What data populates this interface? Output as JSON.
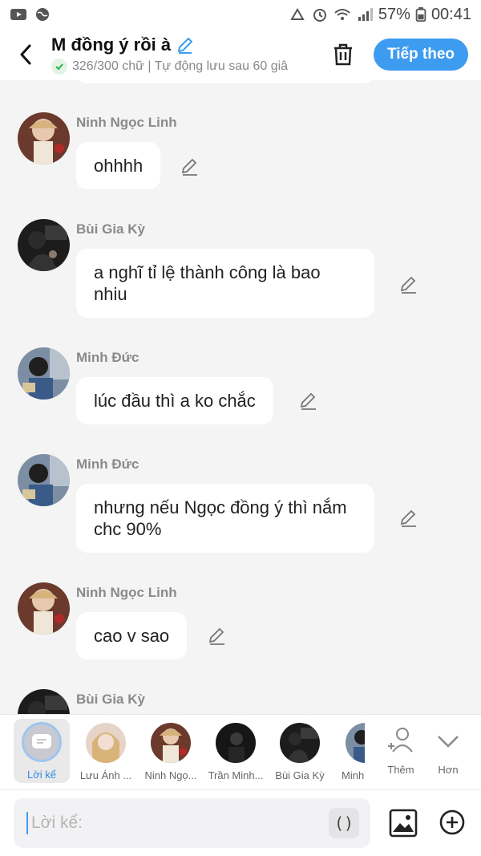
{
  "status_bar": {
    "battery": "57%",
    "time": "00:41"
  },
  "header": {
    "title": "M đồng ý rồi à",
    "subtitle": "326/300 chữ | Tự động lưu sau 60 giâ",
    "next_label": "Tiếp theo"
  },
  "messages": [
    {
      "sender": "Ninh Ngọc Linh",
      "text": "ohhhh"
    },
    {
      "sender": "Bùi Gia Kỳ",
      "text": "a nghĩ tỉ lệ thành công là bao nhiu"
    },
    {
      "sender": "Minh Đức",
      "text": "lúc đầu thì a ko chắc"
    },
    {
      "sender": "Minh Đức",
      "text": "nhưng nếu Ngọc đồng ý thì nắm chc 90%"
    },
    {
      "sender": "Ninh Ngọc Linh",
      "text": "cao v sao"
    },
    {
      "sender": "Bùi Gia Kỳ",
      "text": ""
    }
  ],
  "characters": [
    {
      "label": "Lời kể"
    },
    {
      "label": "Lưu Ánh ..."
    },
    {
      "label": "Ninh Ngọ..."
    },
    {
      "label": "Trần Minh..."
    },
    {
      "label": "Bùi Gia Kỳ"
    },
    {
      "label": "Minh"
    }
  ],
  "add_label": "Thêm",
  "more_label": "Hơn",
  "input": {
    "placeholder": "Lời kể:",
    "paren": "()"
  },
  "colors": {
    "accent": "#3d9cf0",
    "background": "#f4f4f4",
    "bubble": "#ffffff"
  }
}
